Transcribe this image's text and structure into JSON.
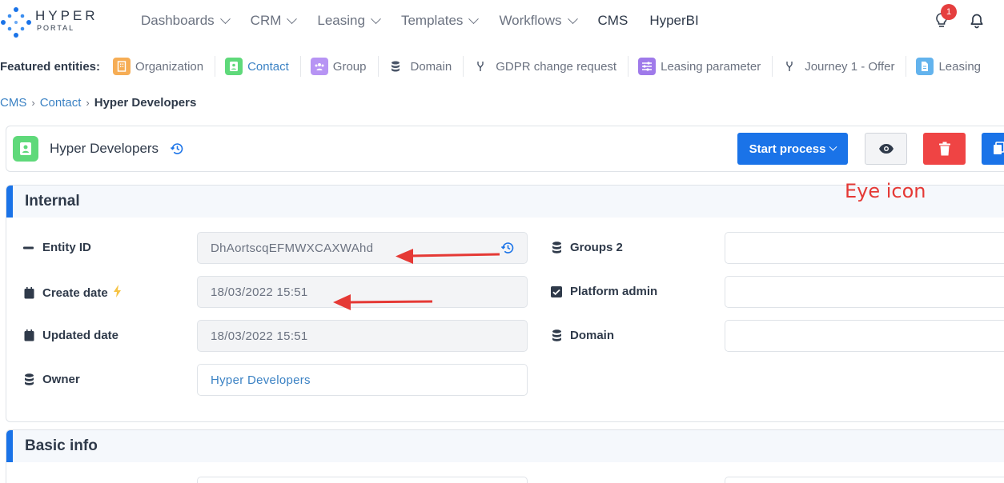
{
  "app": {
    "logo_top": "HYPER",
    "logo_bottom": "PORTAL"
  },
  "nav": {
    "items": [
      {
        "label": "Dashboards",
        "dropdown": true
      },
      {
        "label": "CRM",
        "dropdown": true
      },
      {
        "label": "Leasing",
        "dropdown": true
      },
      {
        "label": "Templates",
        "dropdown": true
      },
      {
        "label": "Workflows",
        "dropdown": true
      },
      {
        "label": "CMS",
        "dropdown": false
      },
      {
        "label": "HyperBI",
        "dropdown": false
      }
    ],
    "notification_count": "1"
  },
  "featured": {
    "label": "Featured entities:",
    "items": [
      {
        "label": "Organization",
        "icon": "building-icon",
        "color": "#f6ad55"
      },
      {
        "label": "Contact",
        "icon": "contact-card-icon",
        "color": "#5fd97a",
        "active": true
      },
      {
        "label": "Group",
        "icon": "users-icon",
        "color": "#b794f4"
      },
      {
        "label": "Domain",
        "icon": "database-icon",
        "color": ""
      },
      {
        "label": "GDPR change request",
        "icon": "branch-icon",
        "color": ""
      },
      {
        "label": "Leasing parameter",
        "icon": "sliders-icon",
        "color": "#9f7aea"
      },
      {
        "label": "Journey 1 - Offer",
        "icon": "branch-icon",
        "color": ""
      },
      {
        "label": "Leasing",
        "icon": "document-icon",
        "color": "#63b3ed"
      }
    ]
  },
  "breadcrumb": {
    "root": "CMS",
    "parent": "Contact",
    "current": "Hyper Developers"
  },
  "header": {
    "title": "Hyper Developers",
    "start_process_label": "Start process",
    "accent_color": "#1a73e8",
    "danger_color": "#ef4444"
  },
  "sections": {
    "internal": {
      "title": "Internal",
      "entity_id_label": "Entity ID",
      "entity_id_value": "DhAortscqEFMWXCAXWAhd",
      "create_date_label": "Create date",
      "create_date_value": "18/03/2022 15:51",
      "updated_date_label": "Updated date",
      "updated_date_value": "18/03/2022 15:51",
      "owner_label": "Owner",
      "owner_value": "Hyper Developers",
      "groups_label": "Groups 2",
      "platform_admin_label": "Platform admin",
      "domain_label": "Domain"
    },
    "basic": {
      "title": "Basic info"
    }
  },
  "annotation": {
    "text": "Eye icon",
    "color": "#e53935"
  }
}
